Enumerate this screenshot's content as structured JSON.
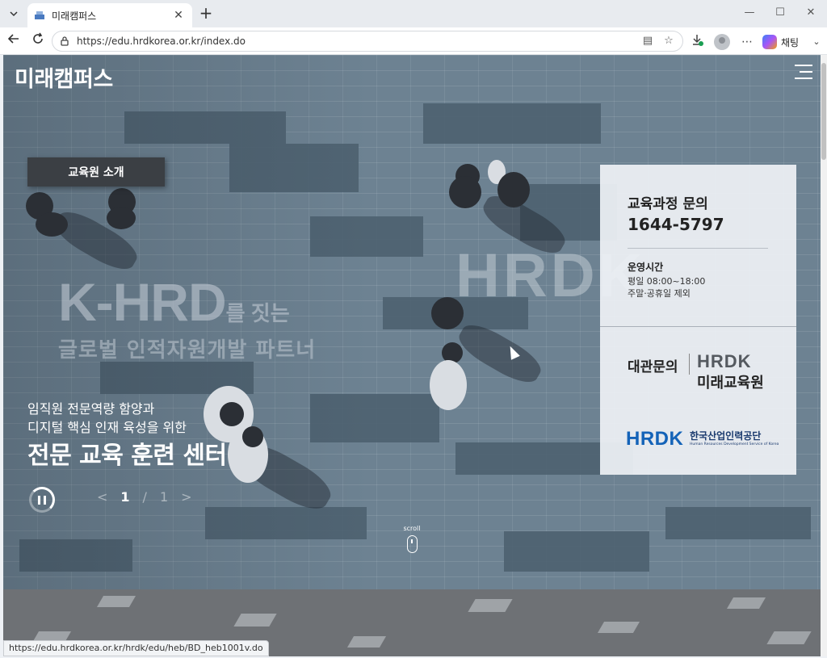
{
  "browser": {
    "tab_title": "미래캠퍼스",
    "url": "https://edu.hrdkorea.or.kr/index.do",
    "copilot_label": "채팅",
    "status_url": "https://edu.hrdkorea.or.kr/hrdk/edu/heb/BD_heb1001v.do"
  },
  "header": {
    "logo": "미래캠퍼스"
  },
  "hero": {
    "intro_button": "교육원 소개",
    "big_title": "K-HRD",
    "big_title_suffix": "를 짓는",
    "big_subtitle": "글로벌 인적자원개발 파트너",
    "ghost_logo": "HRDK",
    "tagline_line1": "임직원 전문역량 함양과",
    "tagline_line2": "디지털 핵심 인재 육성을 위한",
    "headline": "전문 교육 훈련 센터",
    "pager_current": "1",
    "pager_separator": "/",
    "pager_total": "1",
    "scroll_label": "scroll"
  },
  "info_panel": {
    "title": "교육과정 문의",
    "phone": "1644-5797",
    "hours_label": "운영시간",
    "hours_weekday": "평일 08:00~18:00",
    "hours_closed": "주말·공휴일 제외",
    "visit_label": "대관문의",
    "campus_logo_word": "HRDK",
    "campus_logo_name": "미래교육원",
    "agency_logo_word": "HRDK",
    "agency_name": "한국산업인력공단",
    "agency_name_en": "Human Resources Development Service of Korea"
  },
  "colors": {
    "hero_bg": "#6d8292",
    "panel_bg": "#eef1f5",
    "brand_blue": "#1463b8",
    "intro_btn_bg": "#3b3f44"
  }
}
